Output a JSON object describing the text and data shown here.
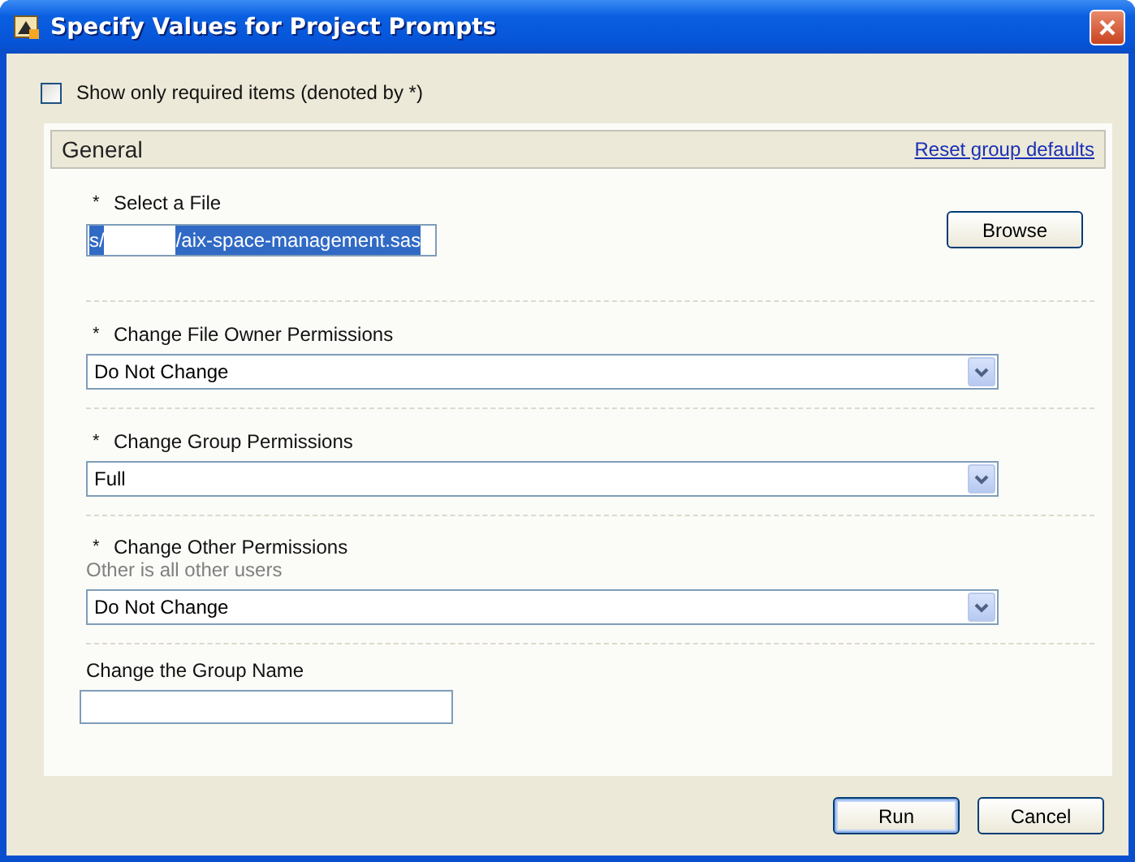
{
  "window": {
    "title": "Specify Values for Project Prompts"
  },
  "required_only": {
    "label": "Show only required items (denoted by",
    "star": "*",
    "suffix": ")",
    "checked": false
  },
  "group": {
    "title": "General",
    "reset_link": "Reset group defaults"
  },
  "prompts": [
    {
      "kind": "file",
      "required": true,
      "star": "*",
      "label": "Select a File",
      "value_parts": [
        "s/",
        "/aix-space-management.sas"
      ],
      "redacted": true,
      "selected": true,
      "button": "Browse"
    },
    {
      "kind": "select",
      "required": true,
      "star": "*",
      "label": "Change File Owner Permissions",
      "value": "Do Not Change"
    },
    {
      "kind": "select",
      "required": true,
      "star": "*",
      "label": "Change Group Permissions",
      "value": "Full"
    },
    {
      "kind": "select",
      "required": true,
      "star": "*",
      "label": "Change Other Permissions",
      "description": "Other is all other users",
      "value": "Do Not Change"
    },
    {
      "kind": "text",
      "required": false,
      "label": "Change the Group Name"
    }
  ],
  "buttons": [
    "Run",
    "Cancel"
  ]
}
